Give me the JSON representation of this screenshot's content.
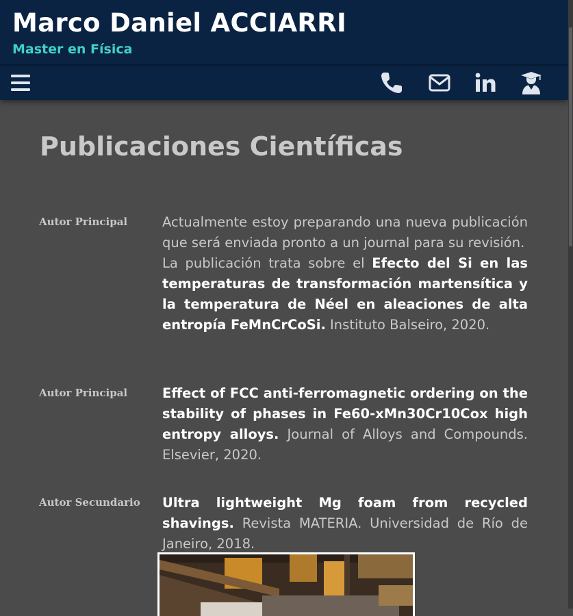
{
  "header": {
    "name": "Marco Daniel ACCIARRI",
    "degree": "Master en Física",
    "icons": [
      "menu-icon",
      "phone-icon",
      "mail-icon",
      "linkedin-icon",
      "graduate-icon"
    ]
  },
  "colors": {
    "header_bg": "#0b2343",
    "accent": "#3fd0c9",
    "page_bg": "#4b4b4b"
  },
  "main": {
    "title": "Publicaciones Científicas",
    "publications": [
      {
        "role": "Autor Principal",
        "intro": "Actualmente estoy preparando una nueva publicación que será enviada pronto a un journal para su revisión.",
        "lead": "La publicación trata sobre el ",
        "title": "Efecto del Si en las temperaturas de transformación martensítica y la temperatura de Néel en aleaciones de alta entropía FeMnCrCoSi.",
        "source": " Instituto Balseiro, 2020."
      },
      {
        "role": "Autor Principal",
        "title": "Effect of FCC anti-ferromagnetic ordering on the stability of phases in Fe60-xMn30Cr10Cox high entropy alloys.",
        "source": " Journal of Alloys and Compounds. Elsevier, 2020."
      },
      {
        "role": "Autor Secundario",
        "title": "Ultra lightweight Mg foam from recycled shavings.",
        "source": " Revista MATERIA. Universidad de Río de Janeiro, 2018."
      }
    ]
  }
}
